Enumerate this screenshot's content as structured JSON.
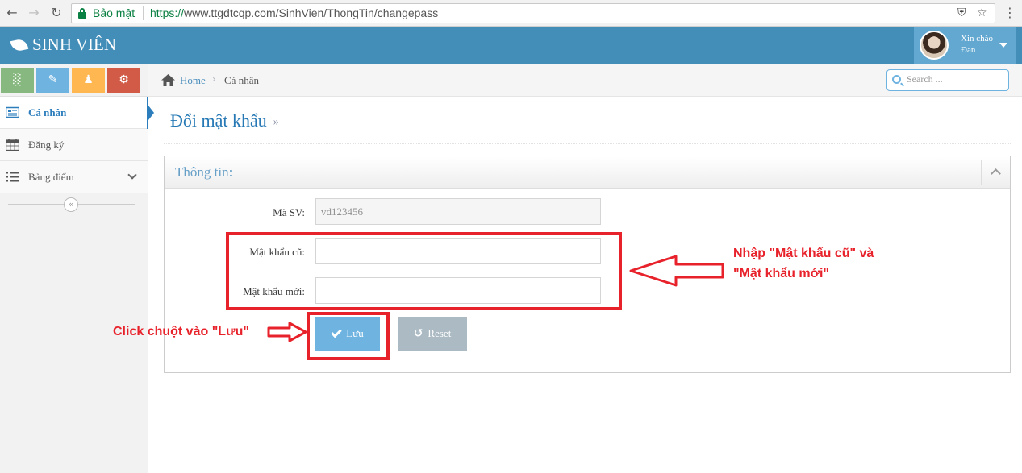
{
  "browser": {
    "secure_label": "Bảo mật",
    "url_scheme": "https://",
    "url_rest": "www.ttgdtcqp.com/SinhVien/ThongTin/changepass"
  },
  "header": {
    "brand": "SINH VIÊN",
    "greeting": "Xin chào",
    "user_name": "Đan"
  },
  "sidebar": {
    "items": [
      {
        "label": "Cá nhân",
        "icon": "profile-card-icon",
        "active": true
      },
      {
        "label": "Đăng ký",
        "icon": "calendar-icon"
      },
      {
        "label": "Bảng điểm",
        "icon": "list-icon"
      }
    ],
    "collapse_glyph": "«"
  },
  "breadcrumb": {
    "home": "Home",
    "current": "Cá nhân"
  },
  "search": {
    "placeholder": "Search ..."
  },
  "page": {
    "title": "Đổi mật khẩu",
    "title_suffix": "»"
  },
  "widget": {
    "title": "Thông tin:"
  },
  "form": {
    "student_id_label": "Mã SV:",
    "student_id_value": "vd123456",
    "old_password_label": "Mật khẩu cũ:",
    "new_password_label": "Mật khẩu mới:",
    "save_label": "Lưu",
    "reset_label": "Reset"
  },
  "annotations": {
    "password_hint_line1": "Nhập \"Mật khẩu cũ\" và",
    "password_hint_line2": "\"Mật khẩu mới\"",
    "click_hint": "Click chuột vào \"Lưu\""
  },
  "colors": {
    "header_bg": "#438eb9",
    "accent": "#2b7dbc",
    "annotation": "#e8222b",
    "save_button": "#6fb3e0",
    "reset_button": "#abbac3"
  }
}
